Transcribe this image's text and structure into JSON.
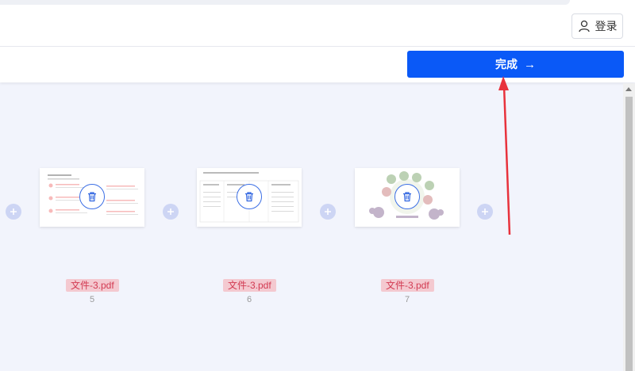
{
  "header": {
    "login_label": "登录",
    "login_icon": "user-icon"
  },
  "toolbar": {
    "done_label": "完成",
    "done_arrow": "→",
    "done_color": "#0a59f7"
  },
  "pages": [
    {
      "filename": "文件-3.pdf",
      "page_number": "5"
    },
    {
      "filename": "文件-3.pdf",
      "page_number": "6"
    },
    {
      "filename": "文件-3.pdf",
      "page_number": "7"
    }
  ],
  "colors": {
    "background": "#f2f4fc",
    "filename_bg": "#f4c9d0",
    "filename_text": "#d23a52",
    "annotation": "#e8323c"
  }
}
